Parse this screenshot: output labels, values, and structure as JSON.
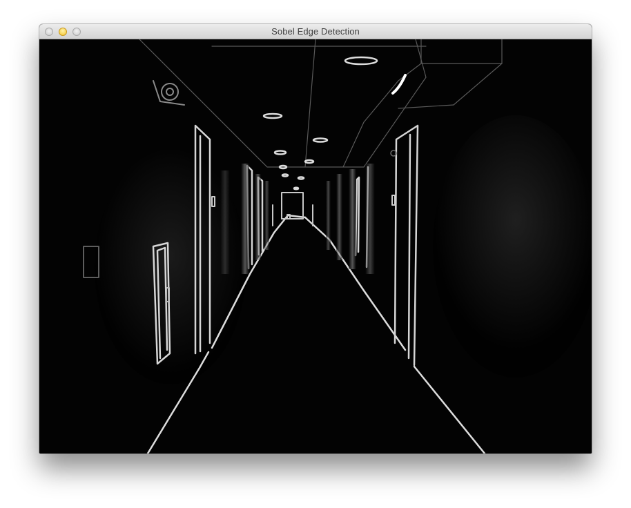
{
  "window": {
    "title": "Sobel Edge Detection",
    "controls": [
      "close",
      "minimize",
      "zoom"
    ]
  },
  "image": {
    "description_icon": "edge-detected-hallway-image",
    "style": "white edges on black background"
  },
  "colors": {
    "titlebar_top": "#ececec",
    "titlebar_bottom": "#d3d3d3",
    "minimize_button": "#f3c42e",
    "canvas_background": "#000000"
  }
}
